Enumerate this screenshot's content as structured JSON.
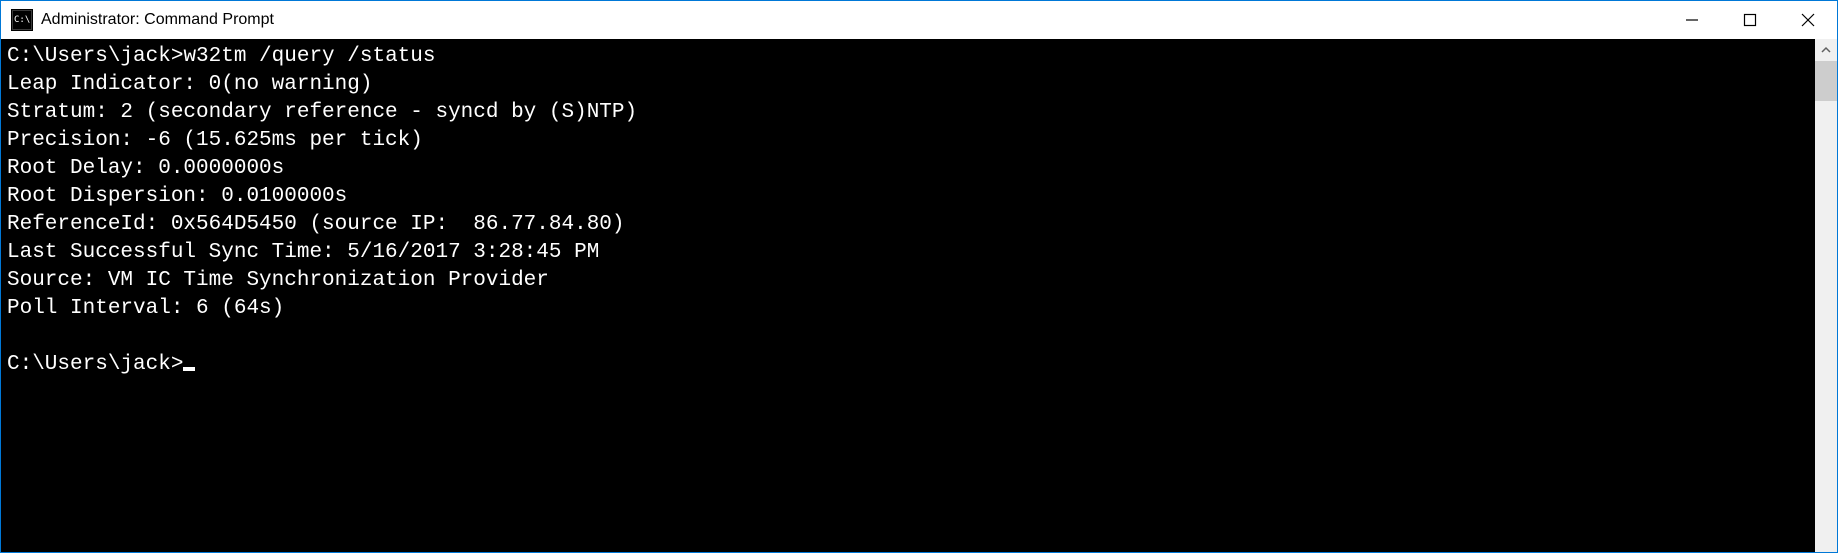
{
  "window": {
    "title": "Administrator: Command Prompt"
  },
  "console": {
    "prompt1_path": "C:\\Users\\jack>",
    "command1": "w32tm /query /status",
    "output": {
      "leap_indicator": "Leap Indicator: 0(no warning)",
      "stratum": "Stratum: 2 (secondary reference - syncd by (S)NTP)",
      "precision": "Precision: -6 (15.625ms per tick)",
      "root_delay": "Root Delay: 0.0000000s",
      "root_dispersion": "Root Dispersion: 0.0100000s",
      "reference_id": "ReferenceId: 0x564D5450 (source IP:  86.77.84.80)",
      "last_sync": "Last Successful Sync Time: 5/16/2017 3:28:45 PM",
      "source": "Source: VM IC Time Synchronization Provider",
      "poll_interval": "Poll Interval: 6 (64s)"
    },
    "prompt2_path": "C:\\Users\\jack>"
  }
}
